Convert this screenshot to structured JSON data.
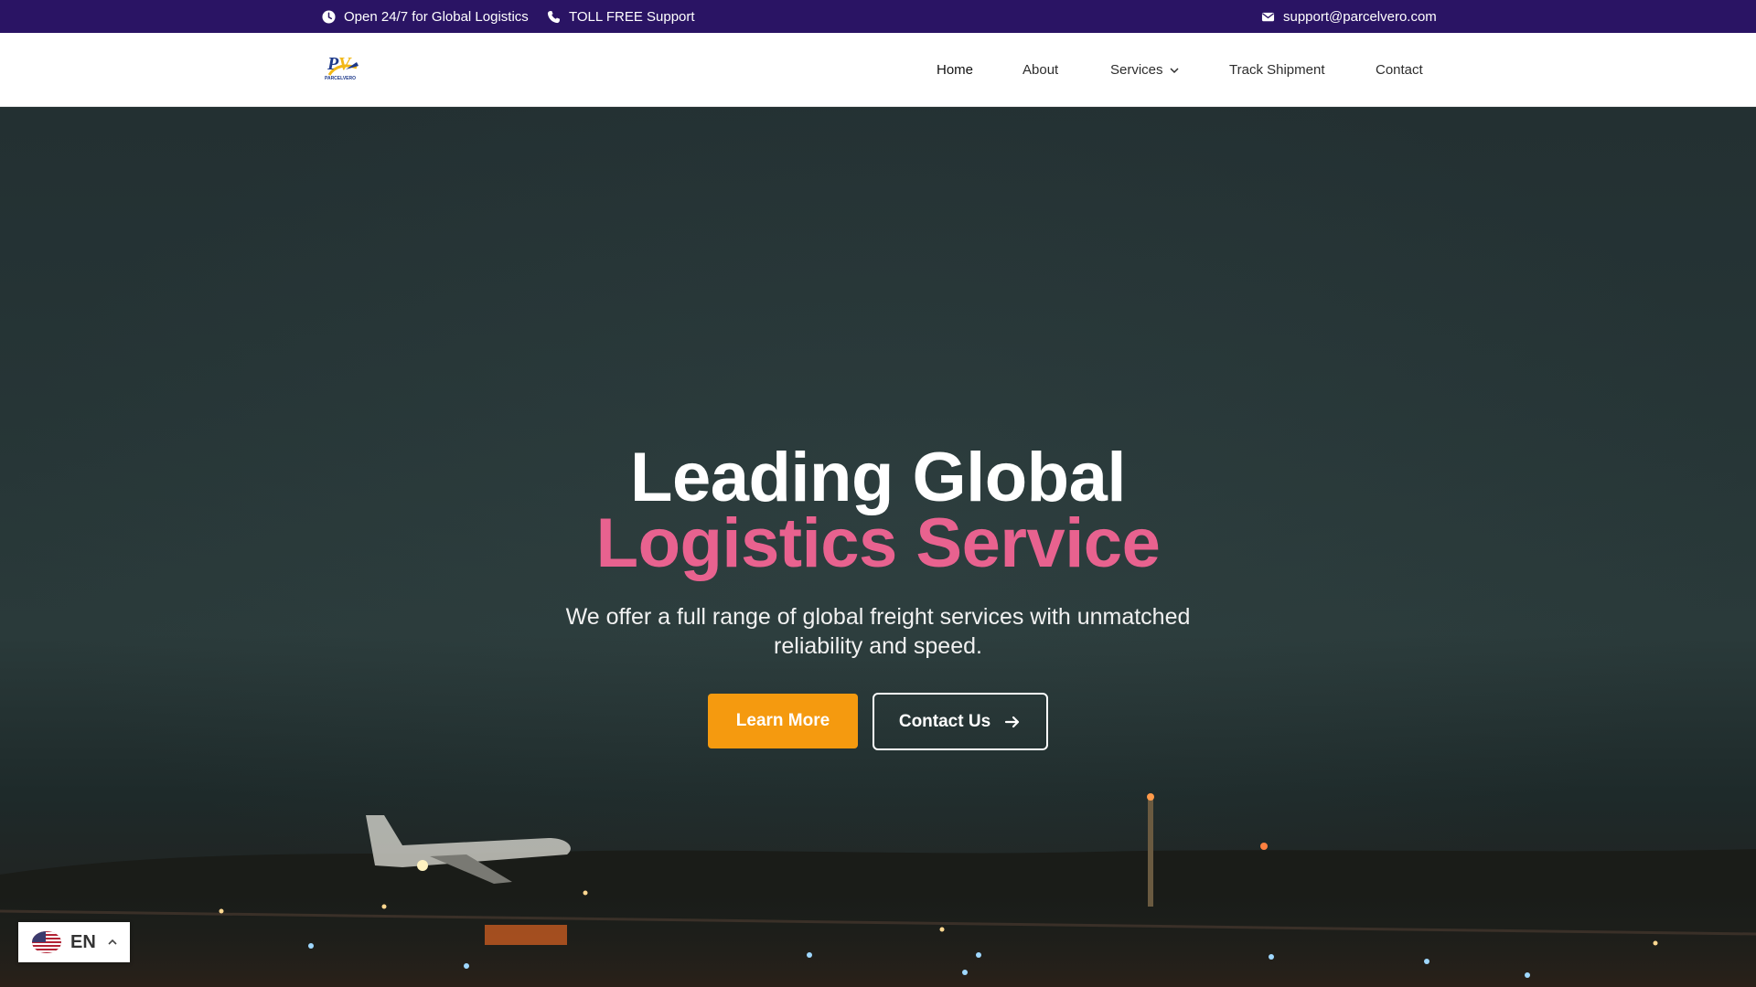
{
  "topbar": {
    "hours": "Open 24/7 for Global Logistics",
    "phone": "TOLL FREE Support",
    "email": "support@parcelvero.com"
  },
  "header": {
    "logo_text": "PARCELVERO",
    "nav": [
      "Home",
      "About",
      "Services",
      "Track Shipment",
      "Contact"
    ]
  },
  "hero": {
    "title_line1": "Leading Global",
    "title_line2": "Logistics Service",
    "subtitle": "We offer a full range of global freight services with unmatched reliability and speed.",
    "primary_button": "Learn More",
    "secondary_button": "Contact Us"
  },
  "language": {
    "code": "EN",
    "flag": "us-flag-icon"
  },
  "colors": {
    "topbar_bg": "#2a1464",
    "accent_pink": "#e8628f",
    "accent_orange": "#f59a0f"
  }
}
